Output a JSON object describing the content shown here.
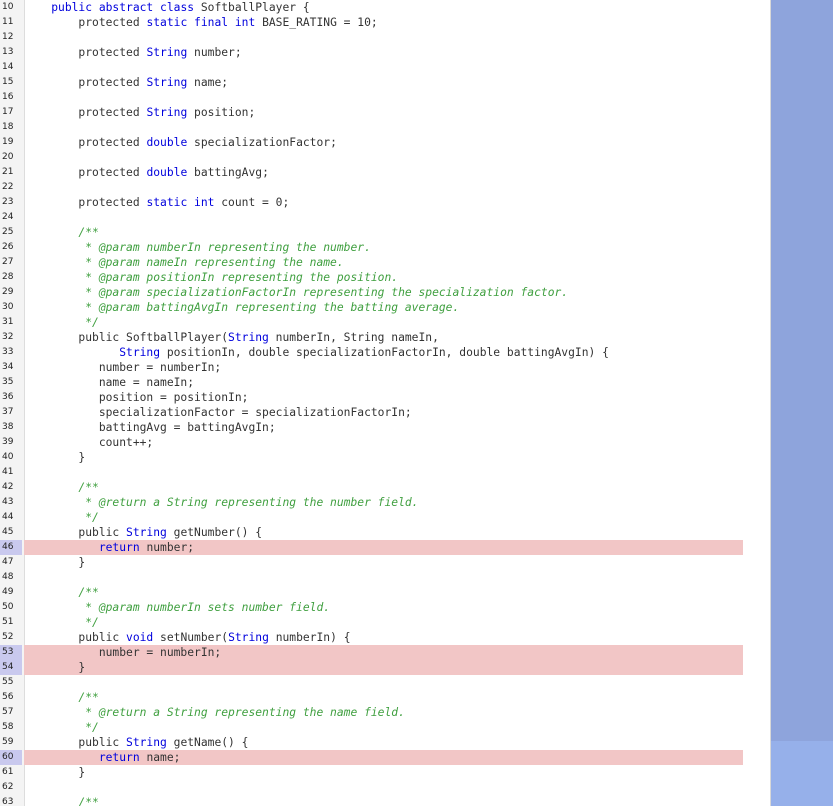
{
  "editor": {
    "lines": [
      {
        "n": "10",
        "hl": false,
        "tokens": [
          [
            "",
            "    "
          ],
          [
            "kw",
            "public abstract class"
          ],
          [
            "",
            " SoftballPlayer {"
          ]
        ]
      },
      {
        "n": "11",
        "hl": false,
        "tokens": [
          [
            "",
            "        protected "
          ],
          [
            "kw",
            "static final int"
          ],
          [
            "",
            " BASE_RATING = 10;"
          ]
        ]
      },
      {
        "n": "12",
        "hl": false,
        "tokens": []
      },
      {
        "n": "13",
        "hl": false,
        "tokens": [
          [
            "",
            "        protected "
          ],
          [
            "kw",
            "String"
          ],
          [
            "",
            " number;"
          ]
        ]
      },
      {
        "n": "14",
        "hl": false,
        "tokens": []
      },
      {
        "n": "15",
        "hl": false,
        "tokens": [
          [
            "",
            "        protected "
          ],
          [
            "kw",
            "String"
          ],
          [
            "",
            " name;"
          ]
        ]
      },
      {
        "n": "16",
        "hl": false,
        "tokens": []
      },
      {
        "n": "17",
        "hl": false,
        "tokens": [
          [
            "",
            "        protected "
          ],
          [
            "kw",
            "String"
          ],
          [
            "",
            " position;"
          ]
        ]
      },
      {
        "n": "18",
        "hl": false,
        "tokens": []
      },
      {
        "n": "19",
        "hl": false,
        "tokens": [
          [
            "",
            "        protected "
          ],
          [
            "kw",
            "double"
          ],
          [
            "",
            " specializationFactor;"
          ]
        ]
      },
      {
        "n": "20",
        "hl": false,
        "tokens": []
      },
      {
        "n": "21",
        "hl": false,
        "tokens": [
          [
            "",
            "        protected "
          ],
          [
            "kw",
            "double"
          ],
          [
            "",
            " battingAvg;"
          ]
        ]
      },
      {
        "n": "22",
        "hl": false,
        "tokens": []
      },
      {
        "n": "23",
        "hl": false,
        "tokens": [
          [
            "",
            "        protected "
          ],
          [
            "kw",
            "static int"
          ],
          [
            "",
            " count = 0;"
          ]
        ]
      },
      {
        "n": "24",
        "hl": false,
        "tokens": []
      },
      {
        "n": "25",
        "hl": false,
        "tokens": [
          [
            "cm",
            "        /**"
          ]
        ]
      },
      {
        "n": "26",
        "hl": false,
        "tokens": [
          [
            "cm",
            "         * @param numberIn representing the number."
          ]
        ]
      },
      {
        "n": "27",
        "hl": false,
        "tokens": [
          [
            "cm",
            "         * @param nameIn representing the name."
          ]
        ]
      },
      {
        "n": "28",
        "hl": false,
        "tokens": [
          [
            "cm",
            "         * @param positionIn representing the position."
          ]
        ]
      },
      {
        "n": "29",
        "hl": false,
        "tokens": [
          [
            "cm",
            "         * @param specializationFactorIn representing the specialization factor."
          ]
        ]
      },
      {
        "n": "30",
        "hl": false,
        "tokens": [
          [
            "cm",
            "         * @param battingAvgIn representing the batting average."
          ]
        ]
      },
      {
        "n": "31",
        "hl": false,
        "tokens": [
          [
            "cm",
            "         */"
          ]
        ]
      },
      {
        "n": "32",
        "hl": false,
        "tokens": [
          [
            "",
            "        public SoftballPlayer("
          ],
          [
            "kw",
            "String"
          ],
          [
            "",
            " numberIn, String nameIn,"
          ]
        ]
      },
      {
        "n": "33",
        "hl": false,
        "tokens": [
          [
            "",
            "              "
          ],
          [
            "kw",
            "String"
          ],
          [
            "",
            " positionIn, double specializationFactorIn, double battingAvgIn) {"
          ]
        ]
      },
      {
        "n": "34",
        "hl": false,
        "tokens": [
          [
            "",
            "           number = numberIn;"
          ]
        ]
      },
      {
        "n": "35",
        "hl": false,
        "tokens": [
          [
            "",
            "           name = nameIn;"
          ]
        ]
      },
      {
        "n": "36",
        "hl": false,
        "tokens": [
          [
            "",
            "           position = positionIn;"
          ]
        ]
      },
      {
        "n": "37",
        "hl": false,
        "tokens": [
          [
            "",
            "           specializationFactor = specializationFactorIn;"
          ]
        ]
      },
      {
        "n": "38",
        "hl": false,
        "tokens": [
          [
            "",
            "           battingAvg = battingAvgIn;"
          ]
        ]
      },
      {
        "n": "39",
        "hl": false,
        "tokens": [
          [
            "",
            "           count++;"
          ]
        ]
      },
      {
        "n": "40",
        "hl": false,
        "tokens": [
          [
            "",
            "        }"
          ]
        ]
      },
      {
        "n": "41",
        "hl": false,
        "tokens": []
      },
      {
        "n": "42",
        "hl": false,
        "tokens": [
          [
            "cm",
            "        /**"
          ]
        ]
      },
      {
        "n": "43",
        "hl": false,
        "tokens": [
          [
            "cm",
            "         * @return a String representing the number field."
          ]
        ]
      },
      {
        "n": "44",
        "hl": false,
        "tokens": [
          [
            "cm",
            "         */"
          ]
        ]
      },
      {
        "n": "45",
        "hl": false,
        "tokens": [
          [
            "",
            "        public "
          ],
          [
            "kw",
            "String"
          ],
          [
            "",
            " getNumber() {"
          ]
        ]
      },
      {
        "n": "46",
        "hl": true,
        "tokens": [
          [
            "",
            "           "
          ],
          [
            "kw",
            "return"
          ],
          [
            "",
            " number;"
          ]
        ]
      },
      {
        "n": "47",
        "hl": false,
        "tokens": [
          [
            "",
            "        }"
          ]
        ]
      },
      {
        "n": "48",
        "hl": false,
        "tokens": []
      },
      {
        "n": "49",
        "hl": false,
        "tokens": [
          [
            "cm",
            "        /**"
          ]
        ]
      },
      {
        "n": "50",
        "hl": false,
        "tokens": [
          [
            "cm",
            "         * @param numberIn sets number field."
          ]
        ]
      },
      {
        "n": "51",
        "hl": false,
        "tokens": [
          [
            "cm",
            "         */"
          ]
        ]
      },
      {
        "n": "52",
        "hl": false,
        "tokens": [
          [
            "",
            "        public "
          ],
          [
            "kw",
            "void"
          ],
          [
            "",
            " setNumber("
          ],
          [
            "kw",
            "String"
          ],
          [
            "",
            " numberIn) {"
          ]
        ]
      },
      {
        "n": "53",
        "hl": true,
        "tokens": [
          [
            "",
            "           number = numberIn;"
          ]
        ]
      },
      {
        "n": "54",
        "hl": true,
        "tokens": [
          [
            "",
            "        }"
          ]
        ]
      },
      {
        "n": "55",
        "hl": false,
        "tokens": []
      },
      {
        "n": "56",
        "hl": false,
        "tokens": [
          [
            "cm",
            "        /**"
          ]
        ]
      },
      {
        "n": "57",
        "hl": false,
        "tokens": [
          [
            "cm",
            "         * @return a String representing the name field."
          ]
        ]
      },
      {
        "n": "58",
        "hl": false,
        "tokens": [
          [
            "cm",
            "         */"
          ]
        ]
      },
      {
        "n": "59",
        "hl": false,
        "tokens": [
          [
            "",
            "        public "
          ],
          [
            "kw",
            "String"
          ],
          [
            "",
            " getName() {"
          ]
        ]
      },
      {
        "n": "60",
        "hl": true,
        "tokens": [
          [
            "",
            "           "
          ],
          [
            "kw",
            "return"
          ],
          [
            "",
            " name;"
          ]
        ]
      },
      {
        "n": "61",
        "hl": false,
        "tokens": [
          [
            "",
            "        }"
          ]
        ]
      },
      {
        "n": "62",
        "hl": false,
        "tokens": []
      },
      {
        "n": "63",
        "hl": false,
        "tokens": [
          [
            "cm",
            "        /**"
          ]
        ]
      }
    ]
  },
  "colors": {
    "keyword": "#0000dd",
    "comment": "#3f9f3f",
    "highlight": "#f2c6c6",
    "side_panel": "#8ea4dc"
  }
}
